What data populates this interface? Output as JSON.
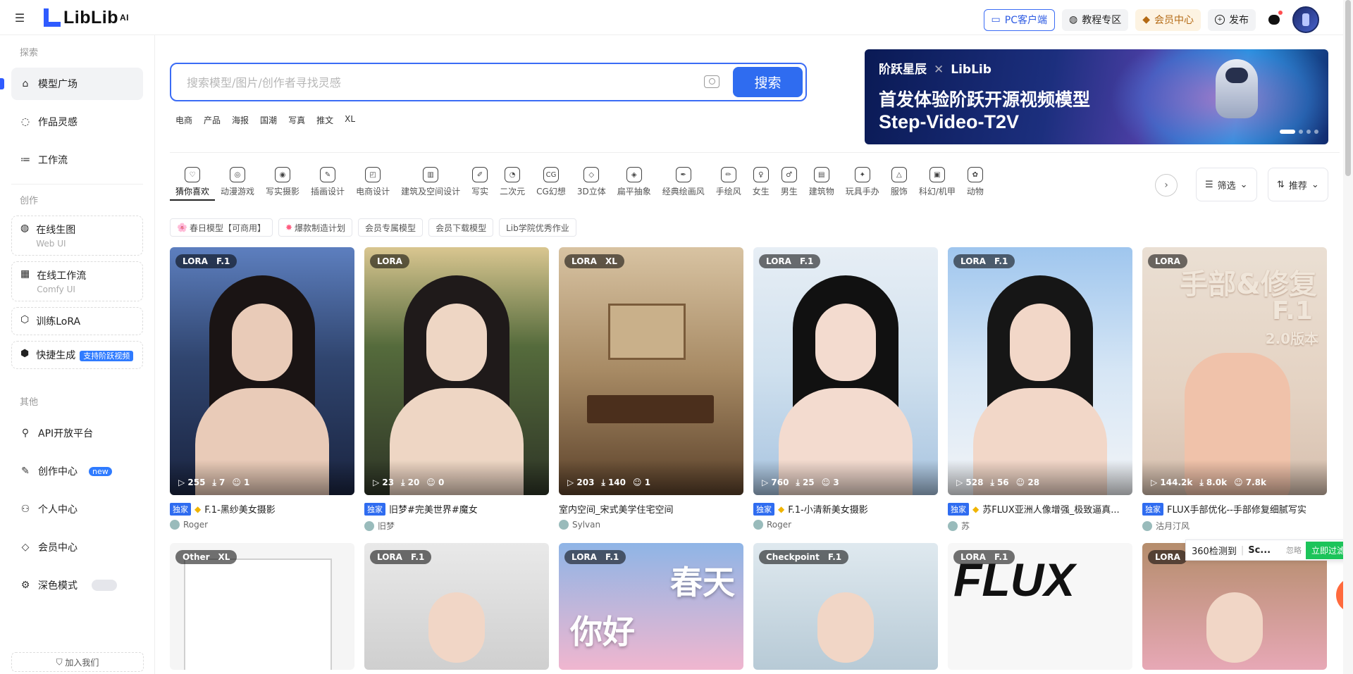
{
  "brand": {
    "name": "LibLib",
    "sup": "AI"
  },
  "topbar": {
    "pc_client": "PC客户端",
    "tutorial": "教程专区",
    "vip": "会员中心",
    "publish": "发布"
  },
  "sidebar": {
    "sec_explore": "探索",
    "explore": [
      {
        "label": "模型广场",
        "icon": "home-icon"
      },
      {
        "label": "作品灵感",
        "icon": "bulb-icon"
      },
      {
        "label": "工作流",
        "icon": "workflow-icon"
      }
    ],
    "sec_create": "创作",
    "create": [
      {
        "label": "在线生图",
        "sub": "Web UI",
        "icon": "palette-icon"
      },
      {
        "label": "在线工作流",
        "sub": "Comfy UI",
        "icon": "flow-icon"
      },
      {
        "label": "训练LoRA",
        "icon": "train-icon"
      },
      {
        "label": "快捷生成",
        "badge": "支持阶跃视频",
        "icon": "quick-icon"
      }
    ],
    "sec_other": "其他",
    "other": [
      {
        "label": "API开放平台",
        "icon": "api-icon"
      },
      {
        "label": "创作中心",
        "badge": "new",
        "icon": "create-center-icon"
      },
      {
        "label": "个人中心",
        "icon": "user-icon"
      },
      {
        "label": "会员中心",
        "icon": "vip-icon"
      },
      {
        "label": "深色模式",
        "icon": "moon-icon"
      }
    ],
    "join": "加入我们"
  },
  "search": {
    "placeholder": "搜索模型/图片/创作者寻找灵感",
    "button": "搜索",
    "hot_tags": [
      "电商",
      "产品",
      "海报",
      "国潮",
      "写真",
      "推文",
      "XL"
    ]
  },
  "banner": {
    "brand": "阶跃星辰",
    "partner": "LibLib",
    "line1": "首发体验阶跃开源视频模型",
    "line2": "Step-Video-T2V"
  },
  "categories": [
    {
      "label": "猜你喜欢",
      "icon": "♡"
    },
    {
      "label": "动漫游戏",
      "icon": "◎"
    },
    {
      "label": "写实摄影",
      "icon": "◉"
    },
    {
      "label": "插画设计",
      "icon": "✎"
    },
    {
      "label": "电商设计",
      "icon": "◰"
    },
    {
      "label": "建筑及空间设计",
      "icon": "▥"
    },
    {
      "label": "写实",
      "icon": "✐"
    },
    {
      "label": "二次元",
      "icon": "◔"
    },
    {
      "label": "CG幻想",
      "icon": "CG"
    },
    {
      "label": "3D立体",
      "icon": "◇"
    },
    {
      "label": "扁平抽象",
      "icon": "◈"
    },
    {
      "label": "经典绘画风",
      "icon": "✒"
    },
    {
      "label": "手绘风",
      "icon": "✏"
    },
    {
      "label": "女生",
      "icon": "♀"
    },
    {
      "label": "男生",
      "icon": "♂"
    },
    {
      "label": "建筑物",
      "icon": "▤"
    },
    {
      "label": "玩具手办",
      "icon": "✦"
    },
    {
      "label": "服饰",
      "icon": "△"
    },
    {
      "label": "科幻/机甲",
      "icon": "▣"
    },
    {
      "label": "动物",
      "icon": "✿"
    }
  ],
  "filters": {
    "filter": "筛选",
    "sort": "推荐"
  },
  "pills": [
    {
      "label": "春日模型【可商用】",
      "emoji": "🌸"
    },
    {
      "label": "爆款制造计划",
      "emoji": "✸"
    },
    {
      "label": "会员专属模型"
    },
    {
      "label": "会员下载模型"
    },
    {
      "label": "Lib学院优秀作业"
    }
  ],
  "cards": [
    {
      "tags": [
        "LORA",
        "F.1"
      ],
      "stats": [
        "255",
        "7",
        "1"
      ],
      "exclusive": "独家",
      "gem": true,
      "title": "F.1-黑纱美女摄影",
      "author": "Roger",
      "bg": "linear-gradient(180deg,#5d7fbf 0%,#30456f 45%,#1a2440 100%)",
      "face": "#e9cbb8",
      "hair": "#1a1414"
    },
    {
      "tags": [
        "LORA"
      ],
      "stats": [
        "23",
        "20",
        "0"
      ],
      "exclusive": "独家",
      "gem": false,
      "title": "旧梦#完美世界#魔女",
      "author": "旧梦",
      "bg": "linear-gradient(180deg,#d9c690 0%,#556b3c 40%,#2e3526 100%)",
      "face": "#eed6c4",
      "hair": "#1f1a1a"
    },
    {
      "tags": [
        "LORA",
        "XL"
      ],
      "stats": [
        "203",
        "140",
        "1"
      ],
      "exclusive": "",
      "gem": false,
      "title": "室内空间_宋式美学住宅空间",
      "author": "Sylvan",
      "bg": "linear-gradient(180deg,#d8c3a2 0%,#a78a64 50%,#5b412a 100%)",
      "face": "",
      "hair": ""
    },
    {
      "tags": [
        "LORA",
        "F.1"
      ],
      "stats": [
        "760",
        "25",
        "3"
      ],
      "exclusive": "独家",
      "gem": true,
      "title": "F.1-小清新美女摄影",
      "author": "Roger",
      "bg": "linear-gradient(180deg,#e7eef5 0%,#cfe0ee 50%,#a8c4e0 100%)",
      "face": "#f3dbcf",
      "hair": "#111"
    },
    {
      "tags": [
        "LORA",
        "F.1"
      ],
      "stats": [
        "528",
        "56",
        "28"
      ],
      "exclusive": "独家",
      "gem": true,
      "title": "苏FLUX亚洲人像增强_极致逼真...",
      "author": "苏",
      "bg": "linear-gradient(180deg,#9fc6ee 0%,#d6e6f5 50%,#f2f4f7 100%)",
      "face": "#f2d7c8",
      "hair": "#161616"
    },
    {
      "tags": [
        "LORA"
      ],
      "stats": [
        "144.2k",
        "8.0k",
        "7.8k"
      ],
      "exclusive": "独家",
      "gem": false,
      "title": "FLUX手部优化--手部修复细腻写实",
      "author": "沽月汀风",
      "bg": "linear-gradient(180deg,#eadfd3 0%,#e4d2c2 60%,#d6bfae 100%)",
      "face": "",
      "hair": "",
      "overlay": "手部&修复",
      "overlay2": "F.1",
      "overlay3": "2.0版本"
    }
  ],
  "cards_row2": [
    {
      "tags": [
        "Other",
        "XL"
      ],
      "bg": "#f5f5f5"
    },
    {
      "tags": [
        "LORA",
        "F.1"
      ],
      "bg": "linear-gradient(180deg,#e9e9e9,#cfcfcf)"
    },
    {
      "tags": [
        "LORA",
        "F.1"
      ],
      "bg": "linear-gradient(180deg,#8fb5e6,#f0b6cf)",
      "overlay": "春天",
      "overlay2": "你好"
    },
    {
      "tags": [
        "Checkpoint",
        "F.1"
      ],
      "bg": "linear-gradient(180deg,#dfe9ef,#b7cad6)"
    },
    {
      "tags": [
        "LORA",
        "F.1"
      ],
      "bg": "#f7f7f7",
      "overlay": "FLUX"
    },
    {
      "tags": [
        "LORA"
      ],
      "bg": "linear-gradient(180deg,#b58d6c,#e7a8b6)"
    }
  ],
  "popup": {
    "text": "360检测到",
    "bold": "Sc...",
    "ignore": "忽略",
    "action": "立即过滤"
  }
}
